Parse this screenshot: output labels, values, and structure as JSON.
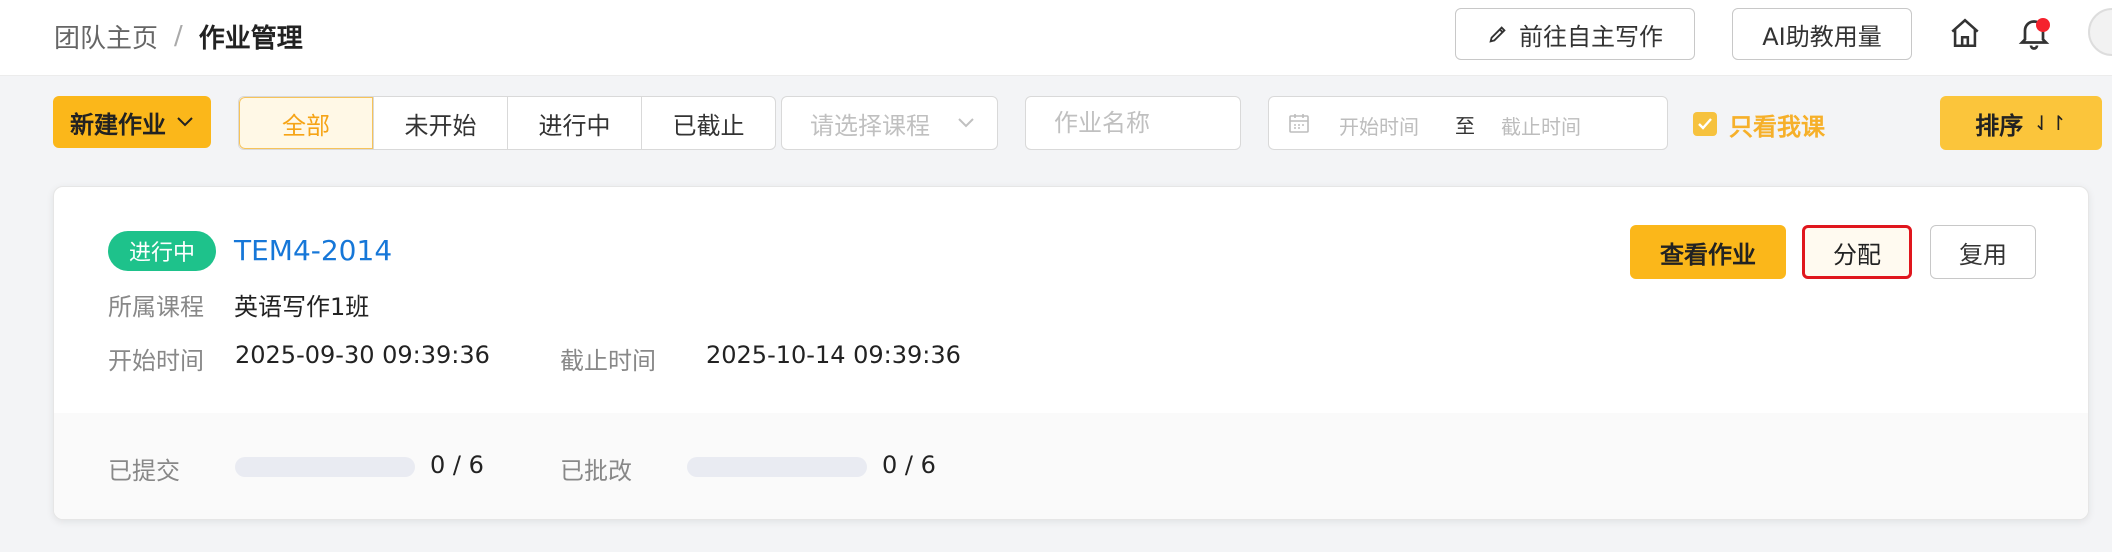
{
  "header": {
    "breadcrumb_home": "团队主页",
    "breadcrumb_sep": "/",
    "breadcrumb_current": "作业管理",
    "write_button": "前往自主写作",
    "ai_button": "AI助教用量",
    "icons": [
      "home-icon",
      "bell-icon",
      "pencil-icon"
    ]
  },
  "toolbar": {
    "new_button": "新建作业",
    "tabs": [
      "全部",
      "未开始",
      "进行中",
      "已截止"
    ],
    "active_tab": "全部",
    "course_select_placeholder": "请选择课程",
    "name_placeholder": "作业名称",
    "date_start_placeholder": "开始时间",
    "date_to": "至",
    "date_end_placeholder": "截止时间",
    "only_mine_label": "只看我课",
    "only_mine_checked": true,
    "sort_button": "排序",
    "sort_icon": "⇃↾"
  },
  "assignments": [
    {
      "status": "进行中",
      "title": "TEM4-2014",
      "course_label": "所属课程",
      "course": "英语写作1班",
      "start_label": "开始时间",
      "start": "2025-09-30 09:39:36",
      "end_label": "截止时间",
      "end": "2025-10-14 09:39:36",
      "submitted_label": "已提交",
      "submitted_text": "0 / 6",
      "submitted_fraction": 0,
      "graded_label": "已批改",
      "graded_text": "0 / 6",
      "graded_fraction": 0,
      "view_button": "查看作业",
      "assign_button": "分配",
      "reuse_button": "复用"
    }
  ],
  "colors": {
    "accent": "#fbb71a",
    "status_green": "#1ec28b",
    "title_blue": "#1677d8",
    "highlight_red": "#e0161d"
  }
}
